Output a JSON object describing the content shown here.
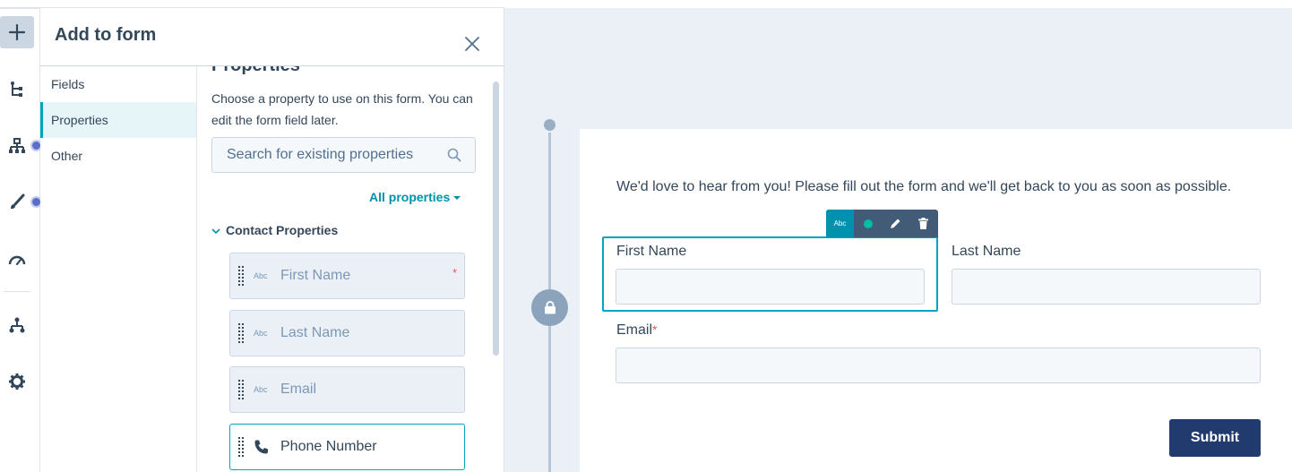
{
  "panel": {
    "title": "Add to form",
    "nav": [
      "Fields",
      "Properties",
      "Other"
    ],
    "active_nav": "Properties",
    "clipped_heading": "Properties",
    "description": "Choose a property to use on this form. You can edit the form field later.",
    "search_placeholder": "Search for existing properties",
    "filter_label": "All properties",
    "group_label": "Contact Properties",
    "properties": [
      {
        "label": "First Name",
        "icon": "abc",
        "required": "*"
      },
      {
        "label": "Last Name",
        "icon": "abc"
      },
      {
        "label": "Email",
        "icon": "abc"
      },
      {
        "label": "Phone Number",
        "icon": "phone-icon"
      }
    ],
    "abc_text": "Abc"
  },
  "form": {
    "intro": "We'd love to hear from you! Please fill out the form and we'll get back to you as soon as possible.",
    "first_name_label": "First Name",
    "last_name_label": "Last Name",
    "email_label": "Email",
    "required_mark": "*",
    "submit_label": "Submit",
    "toolbar_abc": "Abc"
  },
  "colors": {
    "accent": "#00a4bd",
    "link": "#0091ae",
    "submit": "#213b6e",
    "required": "#f2545b",
    "rail_dot": "#5a6ec9"
  }
}
